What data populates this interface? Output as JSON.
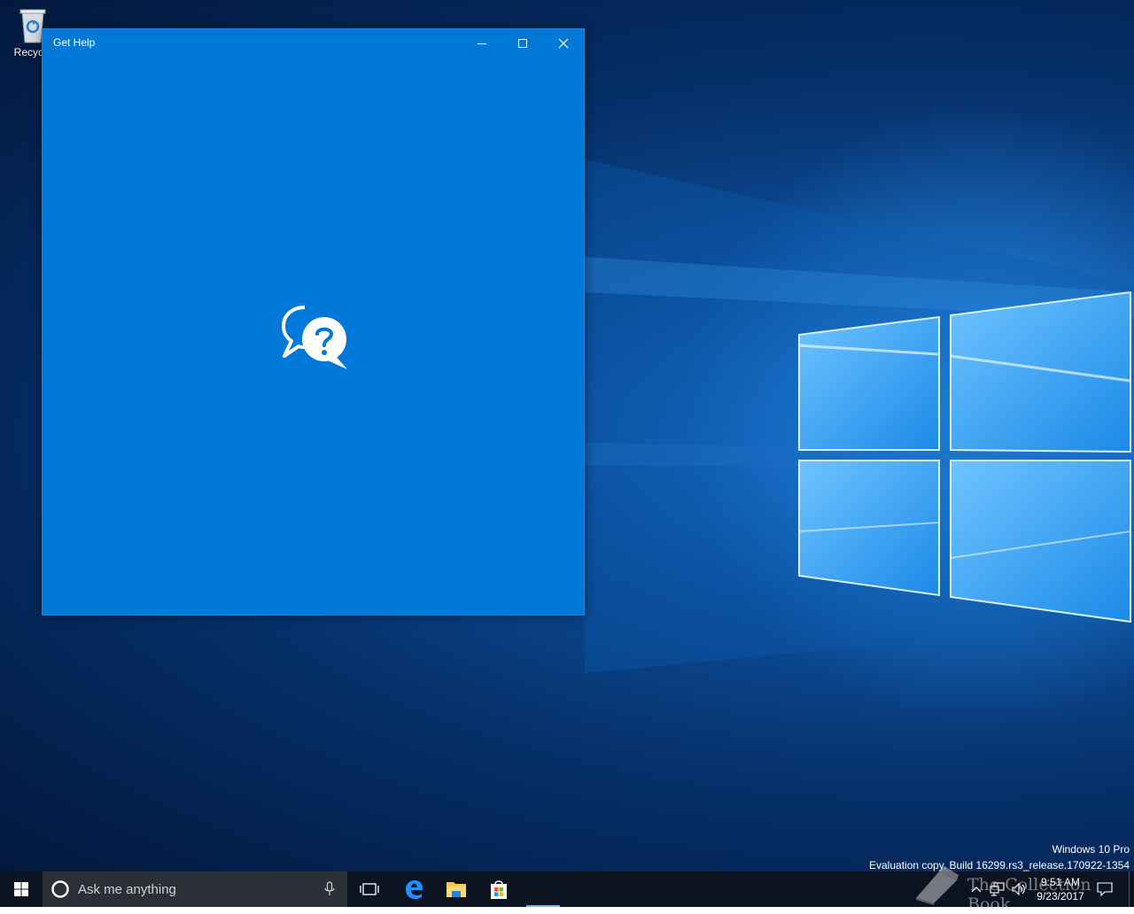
{
  "desktop": {
    "icons": [
      {
        "label": "Recycle",
        "icon": "recycle-bin-icon"
      }
    ],
    "watermark": {
      "line1": "Windows 10 Pro",
      "line2": "Evaluation copy. Build 16299.rs3_release.170922-1354"
    },
    "overlay_text": "The Collection Book"
  },
  "window": {
    "title": "Get Help",
    "background_color": "#0078d7",
    "splash_icon": "help-chat-bubbles-icon",
    "controls": {
      "minimize": "minimize-icon",
      "maximize": "maximize-icon",
      "close": "close-icon"
    }
  },
  "taskbar": {
    "search_placeholder": "Ask me anything",
    "pinned": [
      {
        "name": "Task View",
        "icon": "task-view-icon"
      },
      {
        "name": "Microsoft Edge",
        "icon": "edge-icon"
      },
      {
        "name": "File Explorer",
        "icon": "file-explorer-icon"
      },
      {
        "name": "Store",
        "icon": "store-icon"
      },
      {
        "name": "Get Help",
        "icon": "get-help-icon",
        "active": true
      }
    ],
    "clock": {
      "time": "9:51 AM",
      "date": "9/23/2017"
    },
    "accent_color": "#76b9ed"
  }
}
